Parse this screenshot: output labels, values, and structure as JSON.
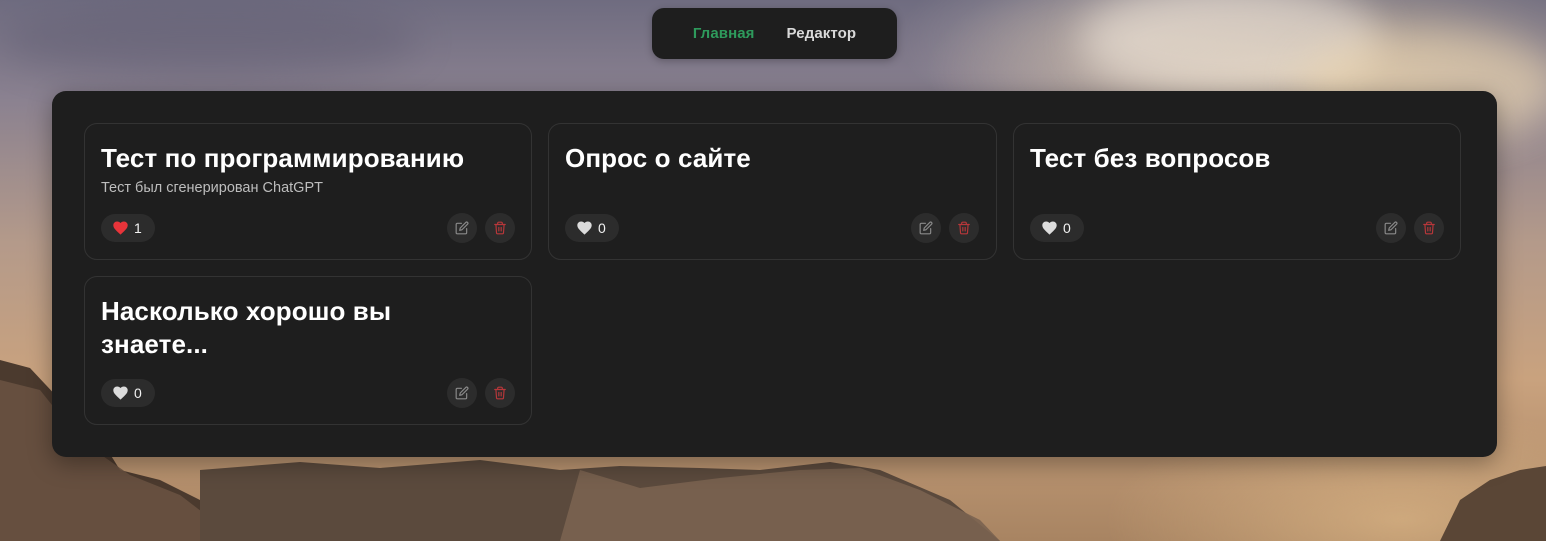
{
  "nav": {
    "home_label": "Главная",
    "editor_label": "Редактор",
    "active_color": "#2e9a5c"
  },
  "cards": [
    {
      "title": "Тест по программированию",
      "description": "Тест был сгенерирован ChatGPT",
      "likes": "1",
      "liked": true
    },
    {
      "title": "Опрос о сайте",
      "description": "",
      "likes": "0",
      "liked": false
    },
    {
      "title": "Тест без вопросов",
      "description": "",
      "likes": "0",
      "liked": false
    },
    {
      "title": "Насколько хорошо вы знаете...",
      "description": "",
      "likes": "0",
      "liked": false
    }
  ],
  "icons": {
    "like": "heart-icon",
    "edit": "edit-icon",
    "delete": "trash-icon"
  },
  "colors": {
    "liked_heart": "#e8343a",
    "unliked_heart": "#dcdcdc",
    "delete_icon": "#b8373a",
    "edit_icon": "#8a8a8a",
    "panel_bg": "#1e1e1e"
  }
}
